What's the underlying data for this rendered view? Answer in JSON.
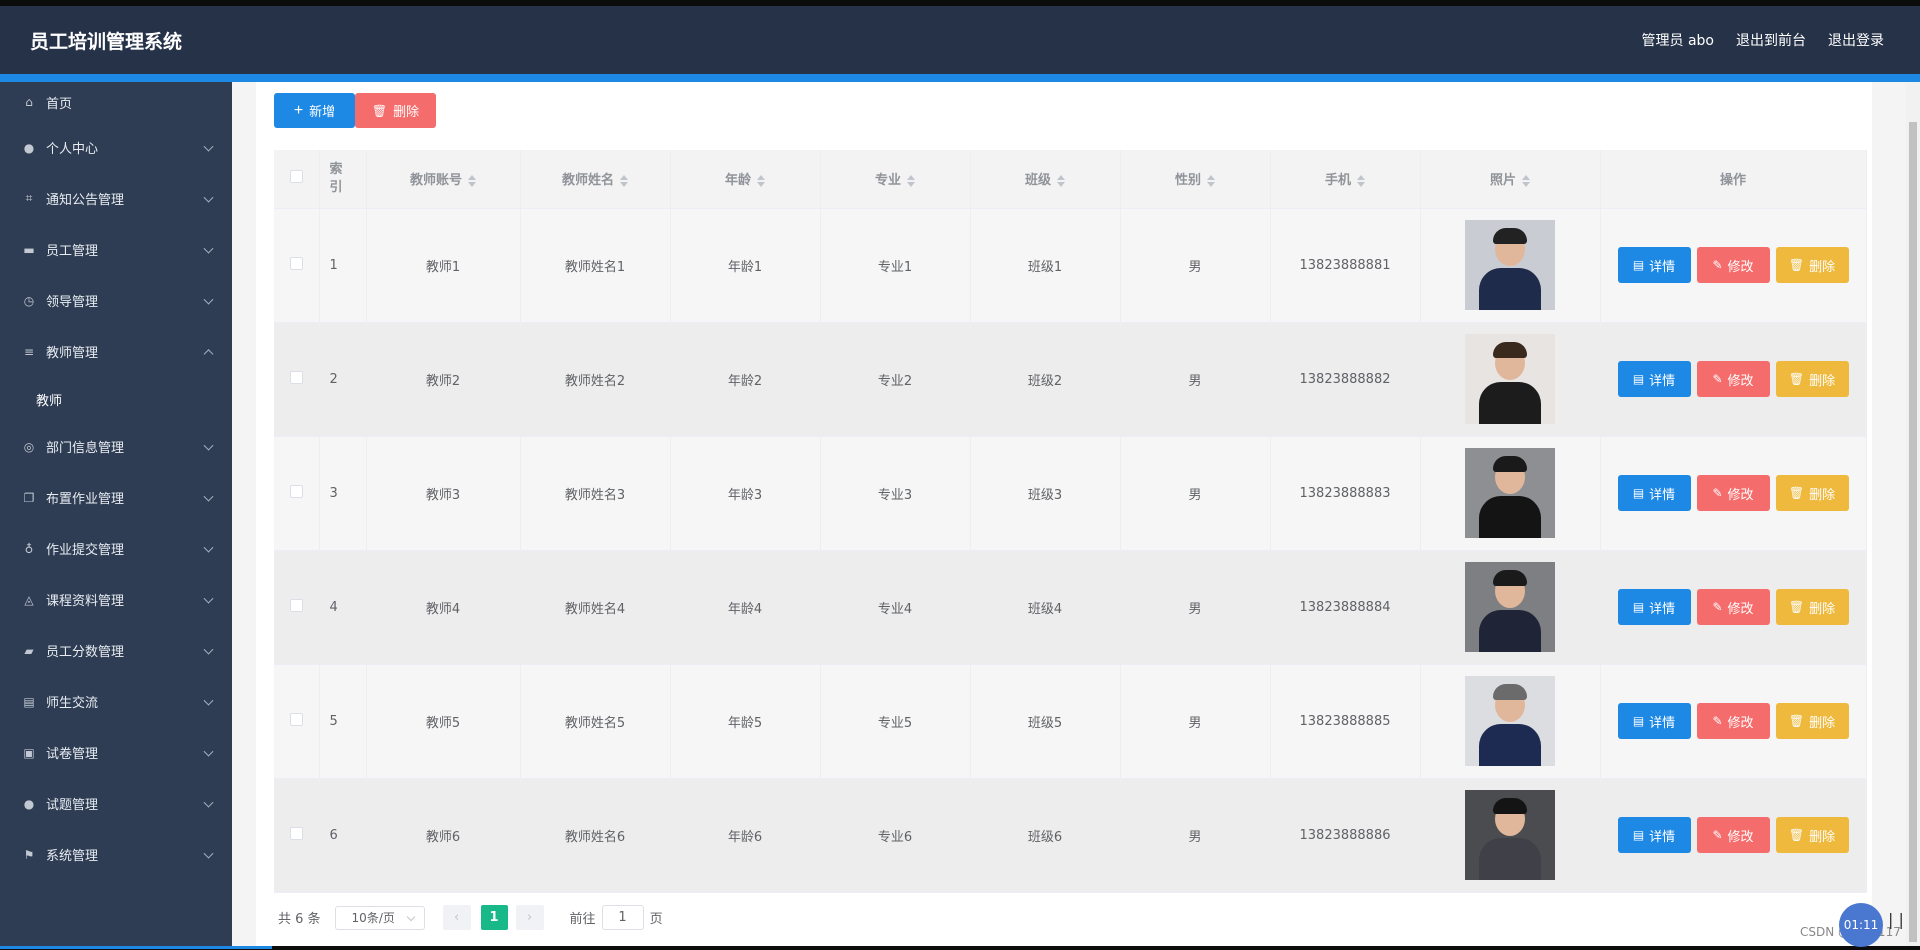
{
  "header": {
    "title": "员工培训管理系统",
    "admin": "管理员 abo",
    "to_front": "退出到前台",
    "logout": "退出登录"
  },
  "sidebar": {
    "items": [
      {
        "label": "首页",
        "icon": "home-icon",
        "glyph": "⌂",
        "expandable": false
      },
      {
        "label": "个人中心",
        "icon": "user-icon",
        "glyph": "●",
        "expandable": true
      },
      {
        "label": "通知公告管理",
        "icon": "crop-icon",
        "glyph": "⌗",
        "expandable": true
      },
      {
        "label": "员工管理",
        "icon": "briefcase-icon",
        "glyph": "▬",
        "expandable": true
      },
      {
        "label": "领导管理",
        "icon": "compass-icon",
        "glyph": "◷",
        "expandable": true
      },
      {
        "label": "教师管理",
        "icon": "menu-icon",
        "glyph": "≡",
        "expandable": true,
        "open": true
      }
    ],
    "submenu": {
      "label": "教师"
    },
    "items2": [
      {
        "label": "部门信息管理",
        "icon": "globe-icon",
        "glyph": "◎",
        "expandable": true
      },
      {
        "label": "布置作业管理",
        "icon": "copy-icon",
        "glyph": "❐",
        "expandable": true
      },
      {
        "label": "作业提交管理",
        "icon": "microphone-icon",
        "glyph": "♁",
        "expandable": true
      },
      {
        "label": "课程资料管理",
        "icon": "bell-icon",
        "glyph": "◬",
        "expandable": true
      },
      {
        "label": "员工分数管理",
        "icon": "ticket-icon",
        "glyph": "▰",
        "expandable": true
      },
      {
        "label": "师生交流",
        "icon": "message-icon",
        "glyph": "▤",
        "expandable": true
      },
      {
        "label": "试卷管理",
        "icon": "paper-icon",
        "glyph": "▣",
        "expandable": true
      },
      {
        "label": "试题管理",
        "icon": "user-icon",
        "glyph": "●",
        "expandable": true
      },
      {
        "label": "系统管理",
        "icon": "flag-icon",
        "glyph": "⚑",
        "expandable": true
      }
    ]
  },
  "toolbar": {
    "add_label": "新增",
    "delete_label": "删除"
  },
  "table": {
    "headers": [
      "索引",
      "教师账号",
      "教师姓名",
      "年龄",
      "专业",
      "班级",
      "性别",
      "手机",
      "照片",
      "操作"
    ],
    "rows": [
      {
        "index": "1",
        "account": "教师1",
        "name": "教师姓名1",
        "age": "年龄1",
        "major": "专业1",
        "class": "班级1",
        "gender": "男",
        "phone": "13823888881"
      },
      {
        "index": "2",
        "account": "教师2",
        "name": "教师姓名2",
        "age": "年龄2",
        "major": "专业2",
        "class": "班级2",
        "gender": "男",
        "phone": "13823888882"
      },
      {
        "index": "3",
        "account": "教师3",
        "name": "教师姓名3",
        "age": "年龄3",
        "major": "专业3",
        "class": "班级3",
        "gender": "男",
        "phone": "13823888883"
      },
      {
        "index": "4",
        "account": "教师4",
        "name": "教师姓名4",
        "age": "年龄4",
        "major": "专业4",
        "class": "班级4",
        "gender": "男",
        "phone": "13823888884"
      },
      {
        "index": "5",
        "account": "教师5",
        "name": "教师姓名5",
        "age": "年龄5",
        "major": "专业5",
        "class": "班级5",
        "gender": "男",
        "phone": "13823888885"
      },
      {
        "index": "6",
        "account": "教师6",
        "name": "教师姓名6",
        "age": "年龄6",
        "major": "专业6",
        "class": "班级6",
        "gender": "男",
        "phone": "13823888886"
      }
    ],
    "actions": {
      "detail": "详情",
      "edit": "修改",
      "delete": "删除"
    }
  },
  "pager": {
    "total": "共 6 条",
    "page_size": "10条/页",
    "prev": "‹",
    "current": "1",
    "next": "›",
    "goto": "前往",
    "goto_value": "1",
    "page_unit": "页"
  },
  "overlay": {
    "timer": "01:11",
    "watermark": "CSDN @shejl117",
    "pause": "| |"
  },
  "colors": {
    "header_bg": "#263248",
    "sidebar_bg": "#2e3d54",
    "primary": "#1e88e5",
    "danger": "#f56c6c",
    "warning": "#eeb93d",
    "pager_active": "#18b889"
  }
}
